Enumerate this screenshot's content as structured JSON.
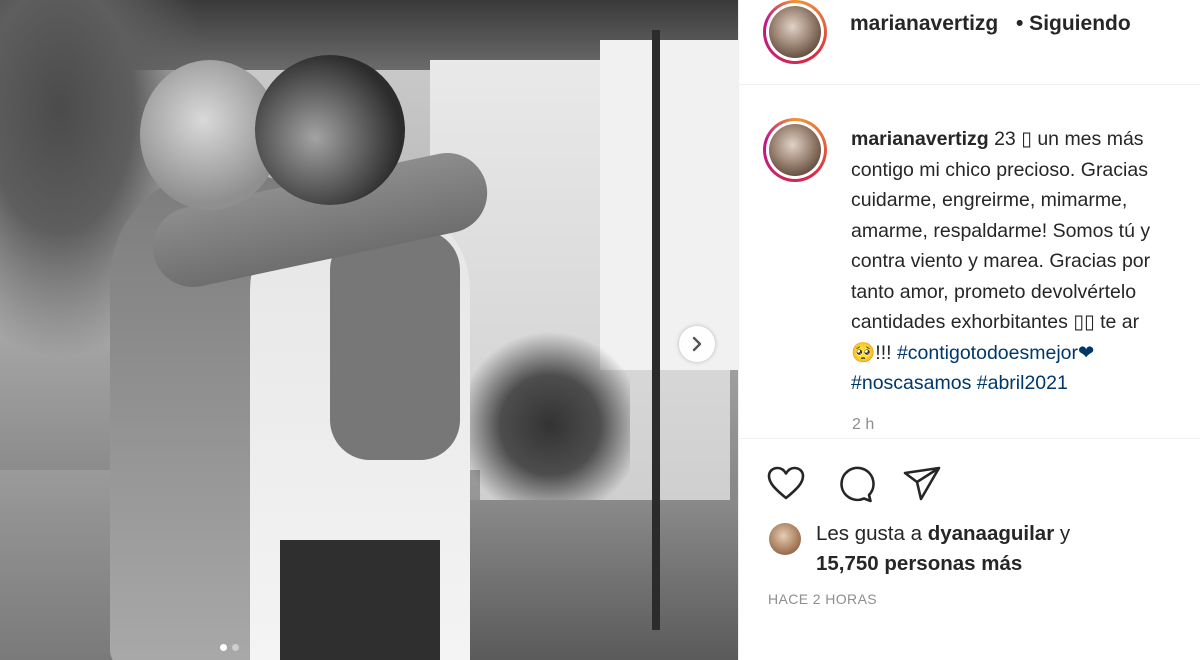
{
  "post": {
    "username": "marianavertizg",
    "follow_status": "• Siguiendo",
    "caption_lines": [
      "23 ▯ un mes más",
      "contigo mi chico precioso. Gracias",
      "cuidarme, engreirme, mimarme,",
      "amarme, respaldarme! Somos tú y",
      "contra viento y marea. Gracias por",
      "tanto amor, prometo devolvértelo",
      "cantidades exhorbitantes ▯▯ te ar"
    ],
    "caption_tail_prefix": "🥺!!! ",
    "hashtag_1": "#contigotodoesmejor",
    "heart_emoji": "❤",
    "hashtag_2": "#noscasamos",
    "hashtag_3": "#abril2021",
    "comment_time": "2 h",
    "likes_prefix": "Les gusta a ",
    "likes_user": "dyanaaguilar",
    "likes_and": " y",
    "likes_count": "15,750 personas más",
    "posted_ago": "HACE 2 HORAS"
  },
  "carousel": {
    "total_slides": 2,
    "active_slide": 1
  },
  "icons": {
    "like": "heart-icon",
    "comment": "comment-icon",
    "share": "send-icon",
    "next": "chevron-right-icon"
  },
  "colors": {
    "text": "#262626",
    "muted": "#8e8e8e",
    "hashtag": "#00376b",
    "border": "#efefef"
  }
}
